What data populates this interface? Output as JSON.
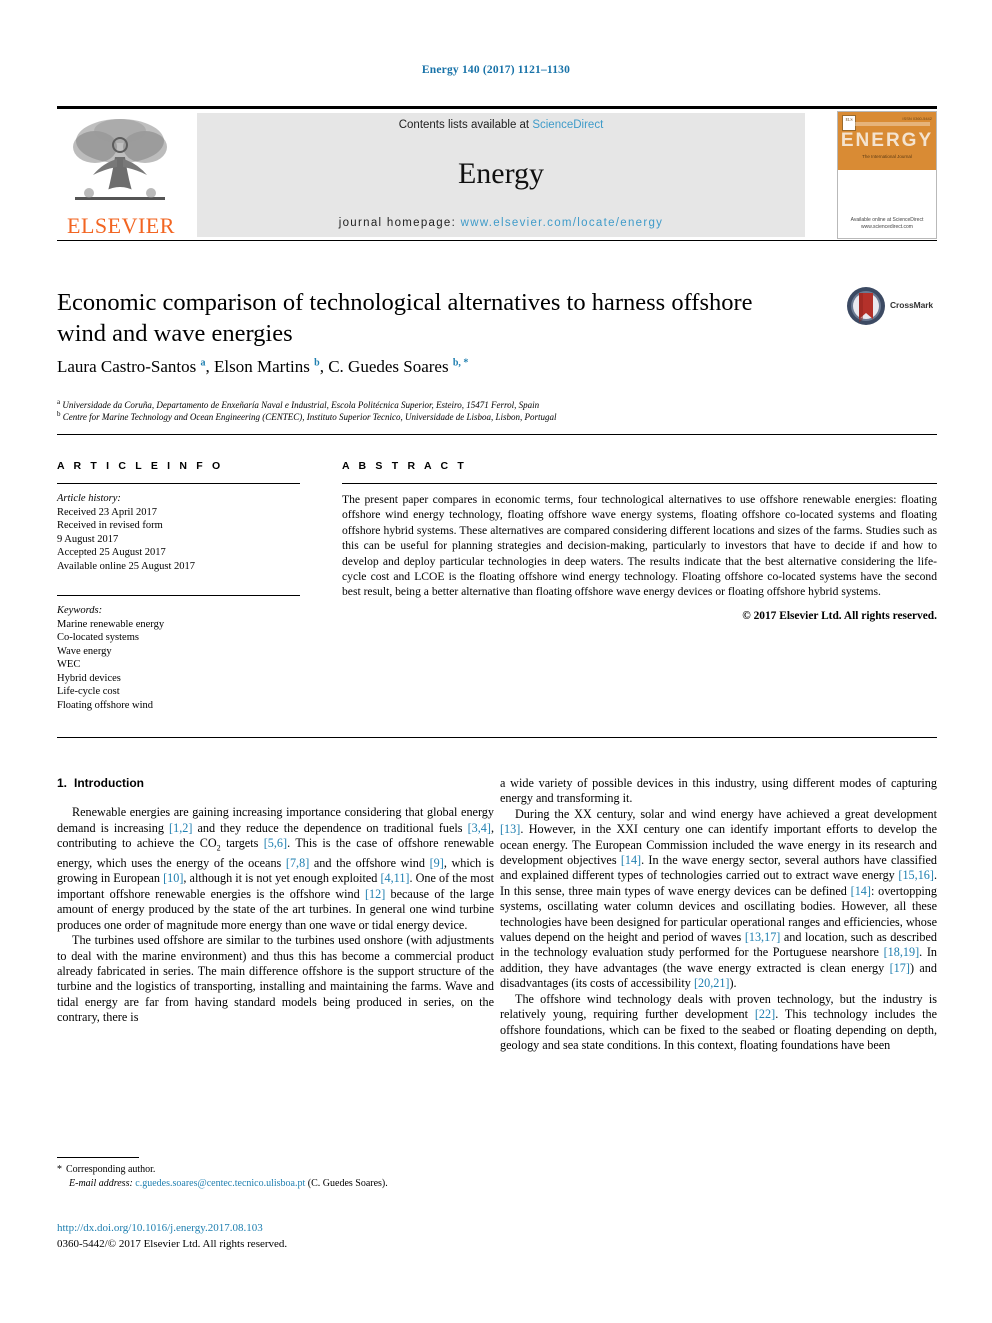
{
  "running_head": "Energy 140 (2017) 1121–1130",
  "banner": {
    "contents_prefix": "Contents lists available at ",
    "sciencedirect": "ScienceDirect",
    "journal_name": "Energy",
    "homepage_prefix": "journal homepage: ",
    "homepage_url": "www.elsevier.com/locate/energy",
    "publisher_wordmark": "ELSEVIER",
    "publisher_logo_icon": "elsevier-tree-icon",
    "cover": {
      "title": "ENERGY",
      "subtitle": "The International Journal",
      "corner_note": "ISSN 0360-5442",
      "bottom_note": "Available online at\nScienceDirect\nwww.sciencedirect.com"
    }
  },
  "article": {
    "title": "Economic comparison of technological alternatives to harness offshore wind and wave energies",
    "crossmark_label": "CrossMark",
    "crossmark_icon": "crossmark-icon",
    "authors_html": "Laura Castro-Santos <sup>a</sup>, Elson Martins <sup>b</sup>, C. Guedes Soares <sup>b, *</sup>",
    "affiliations": [
      {
        "marker": "a",
        "text": "Universidade da Coruña, Departamento de Enxeñaría Naval e Industrial, Escola Politécnica Superior, Esteiro, 15471 Ferrol, Spain"
      },
      {
        "marker": "b",
        "text": "Centre for Marine Technology and Ocean Engineering (CENTEC), Instituto Superior Tecnico, Universidade de Lisboa, Lisbon, Portugal"
      }
    ]
  },
  "article_info": {
    "heading": "A R T I C L E   I N F O",
    "history_label": "Article history:",
    "history": [
      "Received 23 April 2017",
      "Received in revised form",
      "9 August 2017",
      "Accepted 25 August 2017",
      "Available online 25 August 2017"
    ],
    "keywords_label": "Keywords:",
    "keywords": [
      "Marine renewable energy",
      "Co-located systems",
      "Wave energy",
      "WEC",
      "Hybrid devices",
      "Life-cycle cost",
      "Floating offshore wind"
    ]
  },
  "abstract": {
    "heading": "A B S T R A C T",
    "text": "The present paper compares in economic terms, four technological alternatives to use offshore renewable energies: floating offshore wind energy technology, floating offshore wave energy systems, floating offshore co-located systems and floating offshore hybrid systems. These alternatives are compared considering different locations and sizes of the farms. Studies such as this can be useful for planning strategies and decision-making, particularly to investors that have to decide if and how to develop and deploy particular technologies in deep waters. The results indicate that the best alternative considering the life-cycle cost and LCOE is the floating offshore wind energy technology. Floating offshore co-located systems have the second best result, being a better alternative than floating offshore wave energy devices or floating offshore hybrid systems.",
    "copyright": "© 2017 Elsevier Ltd. All rights reserved."
  },
  "body": {
    "section_number": "1.",
    "section_title": "Introduction",
    "left_paragraphs_html": [
      "Renewable energies are gaining increasing importance considering that global energy demand is increasing <span class=\"ref\">[1,2]</span> and they reduce the dependence on traditional fuels <span class=\"ref\">[3,4]</span>, contributing to achieve the CO<sub>2</sub> targets <span class=\"ref\">[5,6]</span>. This is the case of offshore renewable energy, which uses the energy of the oceans <span class=\"ref\">[7,8]</span> and the offshore wind <span class=\"ref\">[9]</span>, which is growing in European <span class=\"ref\">[10]</span>, although it is not yet enough exploited <span class=\"ref\">[4,11]</span>. One of the most important offshore renewable energies is the offshore wind <span class=\"ref\">[12]</span> because of the large amount of energy produced by the state of the art turbines. In general one wind turbine produces one order of magnitude more energy than one wave or tidal energy device.",
      "The turbines used offshore are similar to the turbines used onshore (with adjustments to deal with the marine environment) and thus this has become a commercial product already fabricated in series. The main difference offshore is the support structure of the turbine and the logistics of transporting, installing and maintaining the farms. Wave and tidal energy are far from having standard models being produced in series, on the contrary, there is"
    ],
    "right_paragraphs_html": [
      "a wide variety of possible devices in this industry, using different modes of capturing energy and transforming it.",
      "During the XX century, solar and wind energy have achieved a great development <span class=\"ref\">[13]</span>. However, in the XXI century one can identify important efforts to develop the ocean energy. The European Commission included the wave energy in its research and development objectives <span class=\"ref\">[14]</span>. In the wave energy sector, several authors have classified and explained different types of technologies carried out to extract wave energy <span class=\"ref\">[15,16]</span>. In this sense, three main types of wave energy devices can be defined <span class=\"ref\">[14]</span>: overtopping systems, oscillating water column devices and oscillating bodies. However, all these technologies have been designed for particular operational ranges and efficiencies, whose values depend on the height and period of waves <span class=\"ref\">[13,17]</span> and location, such as described in the technology evaluation study performed for the Portuguese nearshore <span class=\"ref\">[18,19]</span>. In addition, they have advantages (the wave energy extracted is clean energy <span class=\"ref\">[17]</span>) and disadvantages (its costs of accessibility <span class=\"ref\">[20,21]</span>).",
      "The offshore wind technology deals with proven technology, but the industry is relatively young, requiring further development <span class=\"ref\">[22]</span>. This technology includes the offshore foundations, which can be fixed to the seabed or floating depending on depth, geology and sea state conditions. In this context, floating foundations have been"
    ]
  },
  "footer": {
    "corresponding_marker": "*",
    "corresponding_label": "Corresponding author.",
    "email_label": "E-mail address:",
    "email": "c.guedes.soares@centec.tecnico.ulisboa.pt",
    "email_owner": "(C. Guedes Soares).",
    "doi": "http://dx.doi.org/10.1016/j.energy.2017.08.103",
    "issn_line": "0360-5442/© 2017 Elsevier Ltd. All rights reserved."
  },
  "colors": {
    "link_blue": "#1f7fb0",
    "sciencedirect_blue": "#3f9bc9",
    "elsevier_orange": "#F26522",
    "banner_grey": "#e6e6e6",
    "cover_orange": "#d98b34"
  }
}
